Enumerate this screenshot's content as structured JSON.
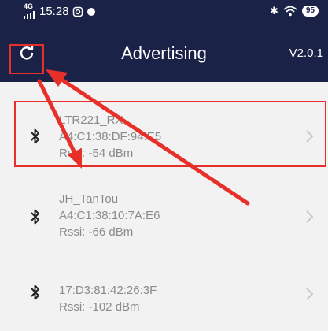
{
  "status_bar": {
    "network": "4G",
    "time": "15:28",
    "battery": "95"
  },
  "app_bar": {
    "title": "Advertising",
    "version": "V2.0.1",
    "refresh_icon": "refresh-icon"
  },
  "devices": [
    {
      "name": "LTR221_RX",
      "mac": "A4:C1:38:DF:94:E5",
      "rssi": "Rssi: -54 dBm",
      "icon": "bluetooth-icon"
    },
    {
      "name": "JH_TanTou",
      "mac": "A4:C1:38:10:7A:E6",
      "rssi": "Rssi: -66 dBm",
      "icon": "bluetooth-icon"
    },
    {
      "name": "",
      "mac": "17:D3:81:42:26:3F",
      "rssi": "Rssi: -102 dBm",
      "icon": "bluetooth-icon"
    }
  ],
  "annotation_color": "#e8302a",
  "header_color": "#1a2248"
}
